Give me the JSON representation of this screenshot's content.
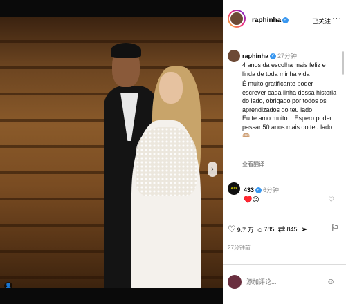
{
  "post": {
    "author": "raphinha",
    "follow_state": "已关注",
    "more": "···",
    "verified_mark": "✓"
  },
  "caption": {
    "author": "raphinha",
    "time": "27分钟",
    "lines": [
      "4 anos da escolha mais feliz e linda de toda minha vida",
      "É muito gratificante poder escrever cada linha dessa historia do lado, obrigado por todos os aprendizados do teu lado",
      "Eu te amo muito... Espero poder passar 50 anos mais do teu lado 🫶🏼"
    ],
    "translate": "查看翻译"
  },
  "comment": {
    "author": "433",
    "avatar_text": "433",
    "time": "6分钟",
    "emojis": "♥️😍",
    "like_icon": "heart-outline-icon"
  },
  "actions": {
    "likes": "9.7 万",
    "comments": "785",
    "shares": "845",
    "post_time": "27分钟前"
  },
  "add_comment": {
    "placeholder": "添加评论..."
  },
  "carousel": {
    "next_glyph": "›",
    "user_tag_glyph": "👤",
    "slide_count": 2,
    "active_slide": 1
  },
  "colors": {
    "accent": "#3897f0",
    "muted": "#8e8e8e",
    "comment_avatar_bg": "#111111",
    "comment_avatar_text": "#e8e100"
  }
}
